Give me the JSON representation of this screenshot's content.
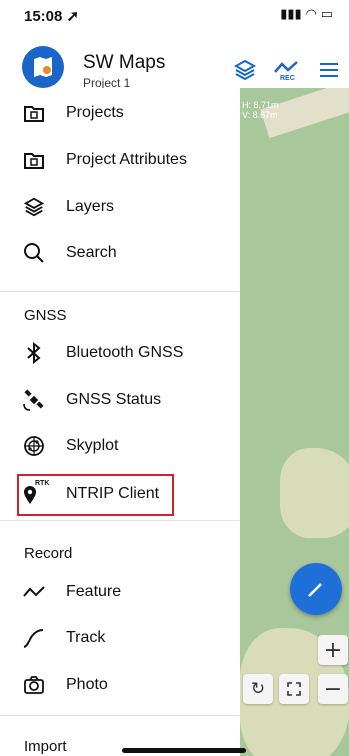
{
  "status_bar": {
    "time": "15:08 ➚",
    "indicators": "▮▮▮ ◠ ▭"
  },
  "header": {
    "app_title": "SW Maps",
    "project": "Project 1",
    "rec_label": "REC"
  },
  "map": {
    "accuracy_h": "H: 8.71m",
    "accuracy_v": "V: 8.67m",
    "zoom_in": "+",
    "zoom_out": "−"
  },
  "menu": {
    "main": [
      {
        "label": "Projects",
        "icon": "folder-icon"
      },
      {
        "label": "Project Attributes",
        "icon": "folder-icon"
      },
      {
        "label": "Layers",
        "icon": "layers-icon"
      },
      {
        "label": "Search",
        "icon": "search-icon"
      }
    ],
    "gnss_header": "GNSS",
    "gnss": [
      {
        "label": "Bluetooth GNSS",
        "icon": "bluetooth-icon"
      },
      {
        "label": "GNSS Status",
        "icon": "satellite-icon"
      },
      {
        "label": "Skyplot",
        "icon": "skyplot-icon"
      },
      {
        "label": "NTRIP Client",
        "icon": "rtk-pin-icon",
        "icon_text": "RTK"
      }
    ],
    "record_header": "Record",
    "record": [
      {
        "label": "Feature",
        "icon": "feature-line-icon"
      },
      {
        "label": "Track",
        "icon": "track-icon"
      },
      {
        "label": "Photo",
        "icon": "camera-icon"
      }
    ],
    "import_header": "Import"
  },
  "colors": {
    "accent": "#1965c8",
    "highlight": "#d0222a",
    "map": "#a8c79b"
  }
}
